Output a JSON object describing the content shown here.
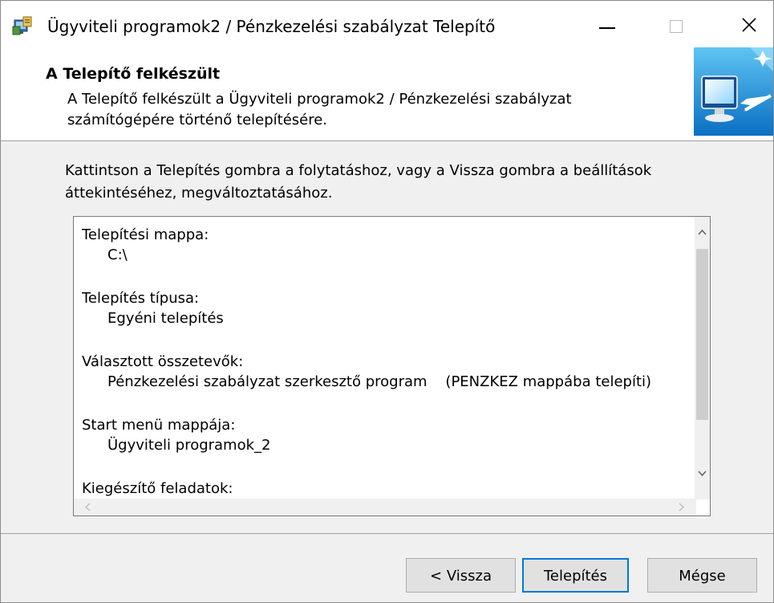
{
  "window": {
    "title": "Ügyviteli programok2 / Pénzkezelési szabályzat Telepítő",
    "icons": {
      "app": "installer-icon",
      "minimize": "minimize-icon",
      "maximize": "maximize-icon",
      "close": "close-icon"
    }
  },
  "header": {
    "title": "A Telepítő felkészült",
    "description": "A Telepítő felkészült a Ügyviteli programok2 / Pénzkezelési szabályzat számítógépére történő telepítésére.",
    "graphic": "computer-install-icon"
  },
  "body": {
    "instruction": "Kattintson a Telepítés gombra a folytatáshoz, vagy a Vissza gombra a beállítások áttekintéséhez, megváltoztatásához."
  },
  "summary": {
    "sections": [
      {
        "label": "Telepítési mappa:",
        "value": "C:\\"
      },
      {
        "label": "Telepítés típusa:",
        "value": "Egyéni telepítés"
      },
      {
        "label": "Választott összetevők:",
        "value": "Pénzkezelési szabályzat szerkesztő program    (PENZKEZ mappába telepíti)"
      },
      {
        "label": "Start menü mappája:",
        "value": "Ügyviteli programok_2"
      },
      {
        "label": "Kiegészítő feladatok:",
        "value": ""
      }
    ]
  },
  "buttons": {
    "back": "< Vissza",
    "install": "Telepítés",
    "cancel": "Mégse"
  },
  "colors": {
    "accent": "#0078d7",
    "window_bg": "#f0f0f0",
    "header_bg": "#ffffff"
  }
}
